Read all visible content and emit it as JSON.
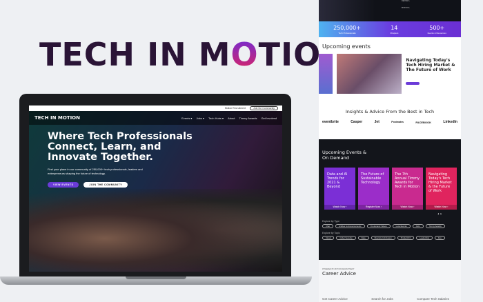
{
  "logo": {
    "pre": "TECH IN M",
    "o": "O",
    "post": "TION"
  },
  "site": {
    "topbar": {
      "link": "Motion Recruitment",
      "cta": "Join the Community"
    },
    "brand": "TECH IN MOTION",
    "nav": [
      "Events ▾",
      "Jobs ▾",
      "Tech Hubs ▾",
      "About",
      "Timmy Awards",
      "Get Involved"
    ],
    "hero": {
      "title": "Where Tech Professionals Connect, Learn, and Innovate Together.",
      "text": "Find your place in our community of 250,000+ tech professionals, leaders and entrepreneurs shaping the future of technology.",
      "btn1": "VIEW EVENTS",
      "btn2": "JOIN THE COMMUNITY"
    }
  },
  "page": {
    "menu": [
      "DENVER ›",
      "BOSTON ›"
    ],
    "stats": [
      {
        "value": "250,000+",
        "label": "Tech Professionals"
      },
      {
        "value": "14",
        "label": "Chapters"
      },
      {
        "value": "500+",
        "label": "Events & Resources"
      }
    ],
    "upcoming": {
      "title": "Upcoming events",
      "feature": "Navigating Today's Tech Hiring Market & The Future of Work"
    },
    "insights": {
      "title": "Insights & Advice From the Best in Tech",
      "logos": [
        "eventbrite",
        "Casper",
        "Jet",
        "Postmates",
        "FACEBOOK",
        "LinkedIn"
      ]
    },
    "ondemand": {
      "title": "Upcoming Events & On Demand",
      "cards": [
        {
          "title": "Data and AI Trends for 2021 & Beyond",
          "cta": "Watch Now ›",
          "color": "#7b2fd6"
        },
        {
          "title": "The Future of Sustainable Technology",
          "cta": "Register Now ›",
          "color": "#9b2dc9"
        },
        {
          "title": "The 7th Annual Timmy Awards for Tech in Motion",
          "cta": "Watch Now ›",
          "color": "#c92a8f"
        },
        {
          "title": "Navigating Today's Tech Hiring Market & the Future of Work",
          "cta": "Watch Now ›",
          "color": "#e0245e"
        }
      ]
    },
    "explore_type": {
      "label": "Explore by Type",
      "chips": [
        "Chat",
        "Articles & Announcements",
        "On-demand Videos",
        "Local Events",
        "Jobs",
        "Timmy Awards"
      ]
    },
    "explore_topic": {
      "label": "Explore by Topic",
      "chips": [
        "Cloud",
        "Cyber Security",
        "Data",
        "Diversity & Inclusion",
        "Product/UX",
        "Leadership",
        "Dev"
      ]
    },
    "career": {
      "eyebrow": "POWERED BY MOTION RECRUITMENT",
      "title": "Career Advice",
      "links": [
        "Get Career Advice",
        "Search for Jobs",
        "Compare Tech Salaries"
      ]
    }
  }
}
